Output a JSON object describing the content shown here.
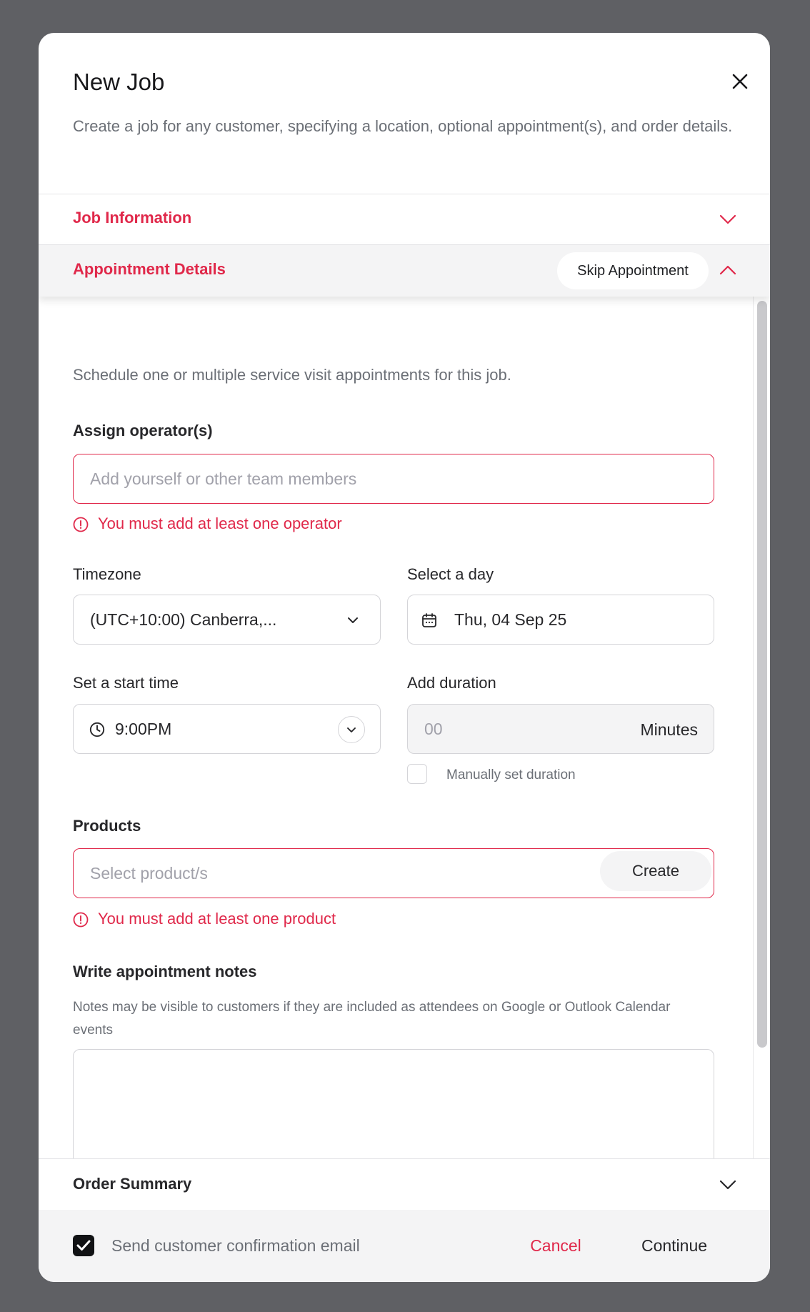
{
  "modal": {
    "title": "New Job",
    "subtitle": "Create a job for any customer, specifying a location, optional appointment(s), and order details."
  },
  "sections": {
    "job_information": "Job Information",
    "appointment_details": "Appointment Details",
    "skip_appointment": "Skip Appointment",
    "order_summary": "Order Summary"
  },
  "appointment": {
    "intro": "Schedule one or multiple service visit appointments for this job.",
    "assign_label": "Assign operator(s)",
    "assign_placeholder": "Add yourself or other team members",
    "assign_error": "You must add at least one operator",
    "timezone_label": "Timezone",
    "timezone_value": "(UTC+10:00) Canberra,...",
    "day_label": "Select a day",
    "day_value": "Thu, 04 Sep 25",
    "start_label": "Set a start time",
    "start_value": "9:00PM",
    "duration_label": "Add duration",
    "duration_placeholder": "00",
    "duration_unit": "Minutes",
    "manual_duration": "Manually set duration",
    "products_label": "Products",
    "products_placeholder": "Select product/s",
    "create_label": "Create",
    "products_error": "You must add at least one product",
    "notes_label": "Write appointment notes",
    "notes_help": "Notes may be visible to customers if they are included as attendees on Google or Outlook Calendar events"
  },
  "footer": {
    "send_email_label": "Send customer confirmation email",
    "cancel": "Cancel",
    "continue": "Continue"
  },
  "colors": {
    "accent": "#e0284a",
    "backdrop": "#5f6064"
  }
}
